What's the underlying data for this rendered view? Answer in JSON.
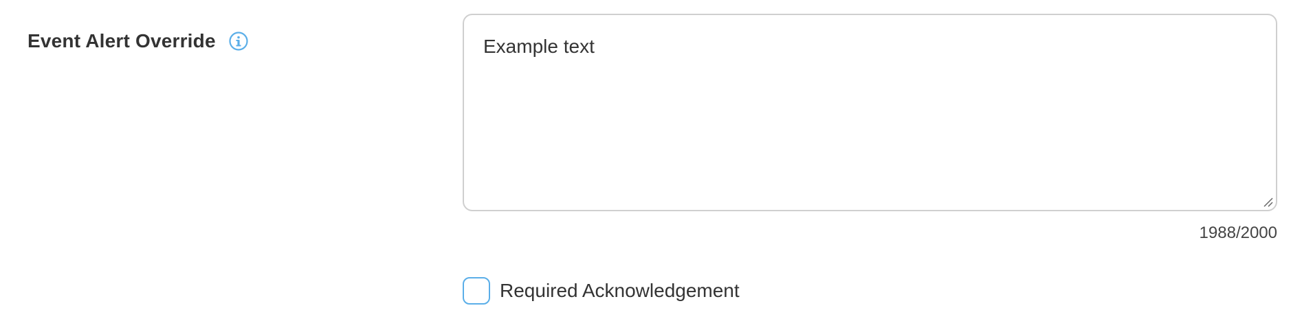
{
  "field": {
    "label": "Event Alert Override",
    "info_icon": "info-circle-icon",
    "textarea_value": "Example text",
    "char_count": "1988/2000"
  },
  "acknowledgement": {
    "label": "Required Acknowledgement",
    "checked": false
  },
  "colors": {
    "accent": "#5aaee8",
    "text": "#333333",
    "border": "#cfcfcf"
  }
}
